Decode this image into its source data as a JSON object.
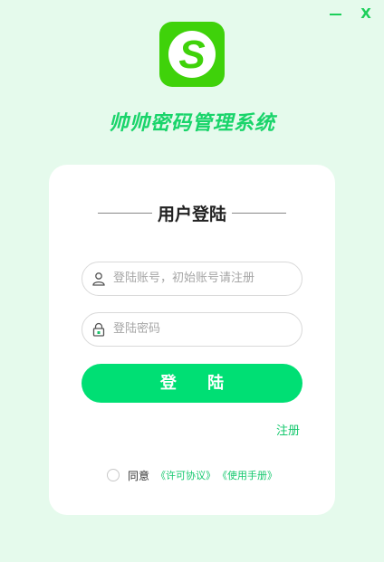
{
  "window": {
    "minimize_icon": "minimize-icon",
    "close_label": "X",
    "accent_color": "#1ccf5a"
  },
  "logo": {
    "letter": "S",
    "bg_color": "#3fd20a"
  },
  "app_title": "帅帅密码管理系统",
  "login": {
    "heading": "用户登陆",
    "account_placeholder": "登陆账号，初始账号请注册",
    "password_placeholder": "登陆密码",
    "login_button": "登 陆",
    "register_link": "注册",
    "agree_text": "同意",
    "license_link": "《许可协议》",
    "manual_link": "《使用手册》",
    "button_color": "#00df74"
  }
}
